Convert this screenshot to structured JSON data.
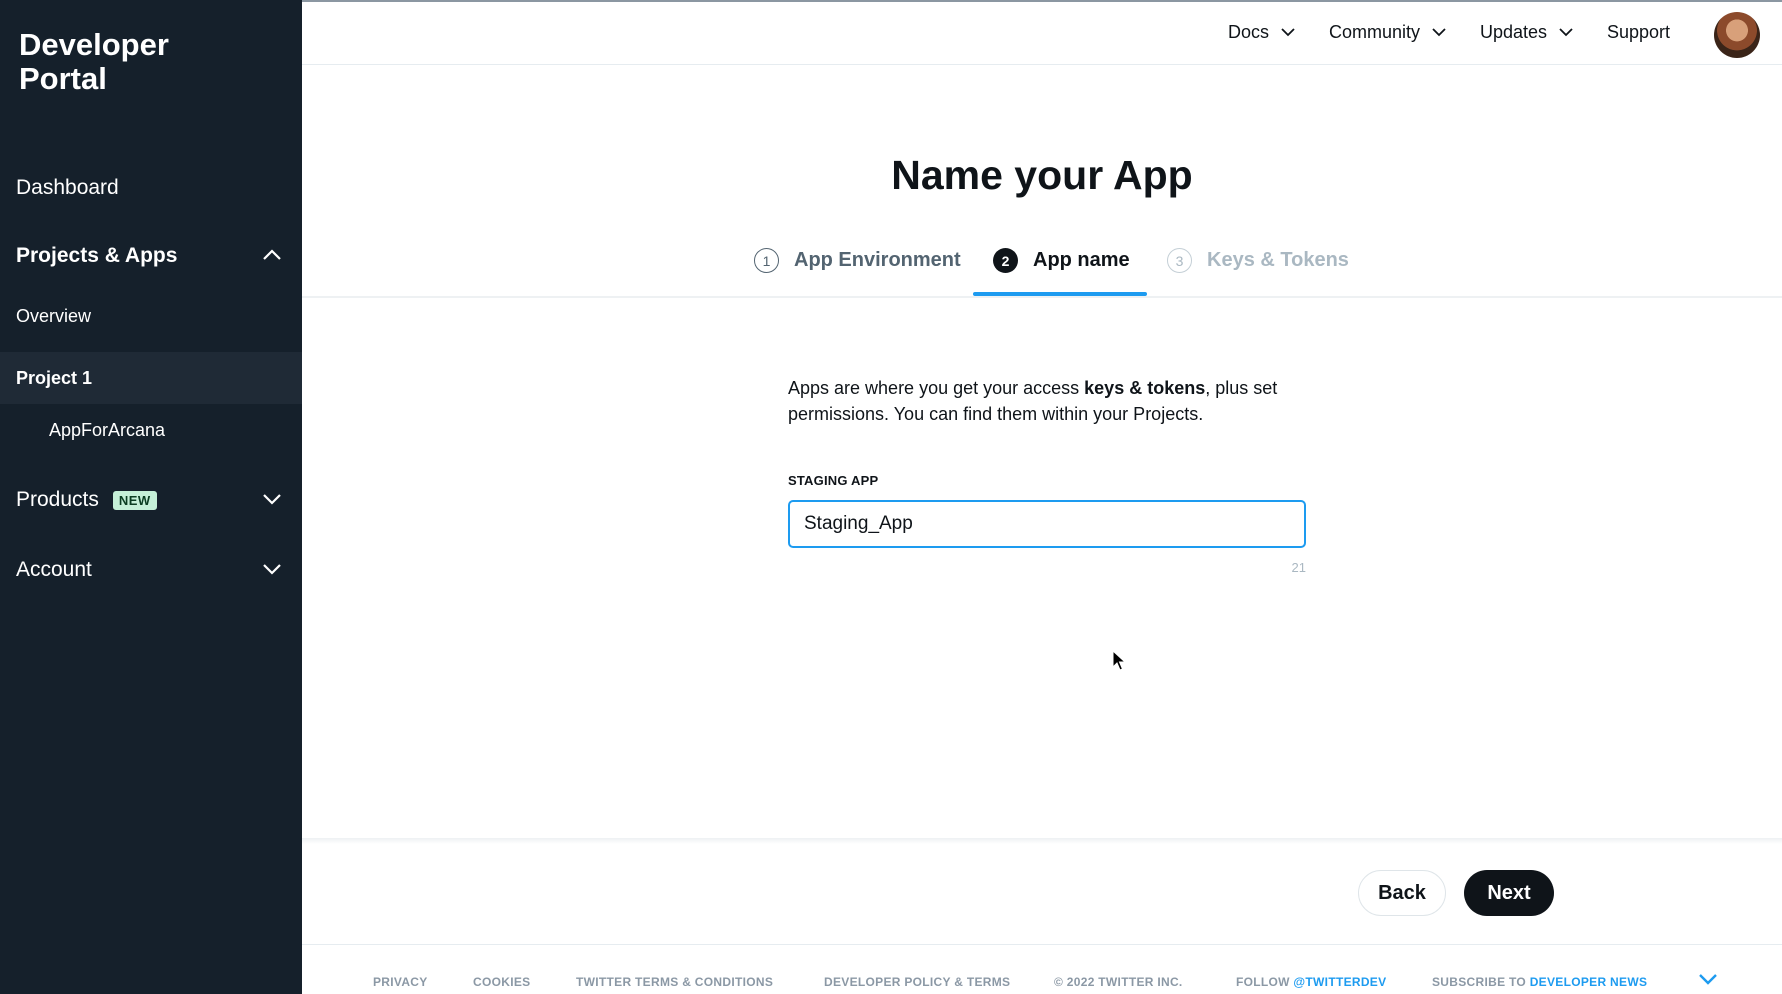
{
  "sidebar": {
    "brand": "Developer Portal",
    "dashboard": "Dashboard",
    "projects_apps": "Projects & Apps",
    "overview": "Overview",
    "project1": "Project 1",
    "app_name": "AppForArcana",
    "products": "Products",
    "products_badge": "NEW",
    "account": "Account"
  },
  "topnav": {
    "docs": "Docs",
    "community": "Community",
    "updates": "Updates",
    "support": "Support"
  },
  "main": {
    "title": "Name your App",
    "steps": [
      {
        "num": "1",
        "label": "App Environment"
      },
      {
        "num": "2",
        "label": "App name"
      },
      {
        "num": "3",
        "label": "Keys & Tokens"
      }
    ],
    "desc_pre": "Apps are where you get your access ",
    "desc_bold": "keys & tokens",
    "desc_post": ", plus set permissions. You can find them within your Projects.",
    "field_label": "STAGING APP",
    "field_value": "Staging_App",
    "char_count": "21"
  },
  "actions": {
    "back": "Back",
    "next": "Next"
  },
  "footer": {
    "privacy": "PRIVACY",
    "cookies": "COOKIES",
    "terms": "TWITTER TERMS & CONDITIONS",
    "policy": "DEVELOPER POLICY & TERMS",
    "copyright": "© 2022 TWITTER INC.",
    "follow_prefix": "FOLLOW ",
    "follow_handle": "@TWITTERDEV",
    "subscribe_prefix": "SUBSCRIBE TO ",
    "subscribe_link": "DEVELOPER NEWS"
  },
  "colors": {
    "sidebar_bg": "#15202b",
    "accent": "#1d9bf0",
    "text": "#0f1419"
  }
}
